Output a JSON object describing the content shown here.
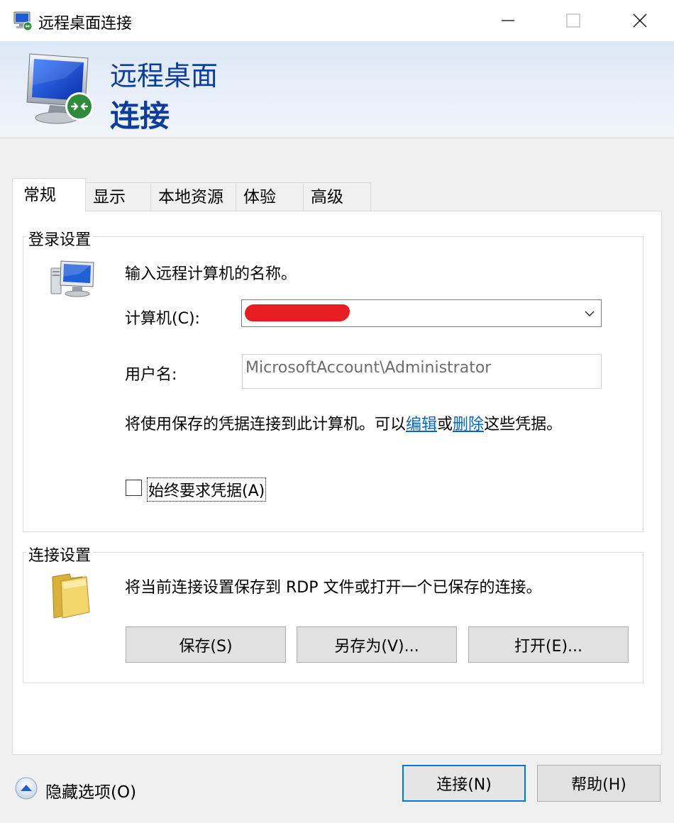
{
  "window": {
    "title": "远程桌面连接",
    "controls": {
      "minimize": "minimize-icon",
      "maximize": "maximize-icon",
      "close": "close-icon"
    }
  },
  "banner": {
    "line1": "远程桌面",
    "line2": "连接"
  },
  "tabs": [
    {
      "label": "常规",
      "active": true
    },
    {
      "label": "显示",
      "active": false
    },
    {
      "label": "本地资源",
      "active": false
    },
    {
      "label": "体验",
      "active": false
    },
    {
      "label": "高级",
      "active": false
    }
  ],
  "login": {
    "title": "登录设置",
    "prompt": "输入远程计算机的名称。",
    "computer_label": "计算机(C):",
    "computer_value": "",
    "username_label": "用户名:",
    "username_value": "MicrosoftAccount\\Administrator",
    "creds_prefix": "将使用保存的凭据连接到此计算机。可以",
    "creds_edit": "编辑",
    "creds_or": "或",
    "creds_delete": "删除",
    "creds_suffix": "这些凭据。",
    "always_ask_label": "始终要求凭据(A)",
    "always_ask_checked": false
  },
  "connection": {
    "title": "连接设置",
    "description": "将当前连接设置保存到 RDP 文件或打开一个已保存的连接。",
    "save": "保存(S)",
    "save_as": "另存为(V)...",
    "open": "打开(E)..."
  },
  "footer": {
    "hide_options": "隐藏选项(O)",
    "connect": "连接(N)",
    "help": "帮助(H)"
  },
  "colors": {
    "banner_text": "#0c3d9c",
    "link": "#0066cc",
    "primary_border": "#0078d7"
  }
}
